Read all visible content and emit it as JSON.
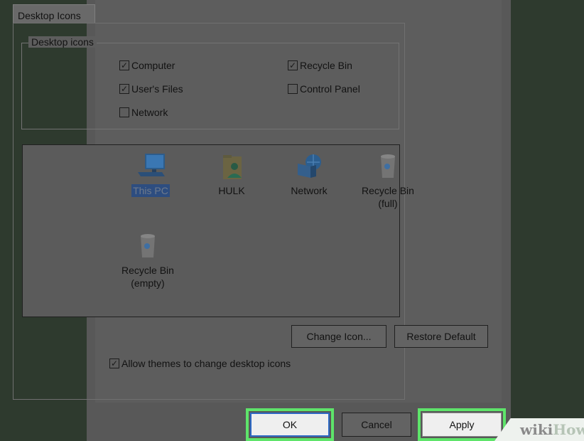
{
  "tab": {
    "label": "Desktop Icons"
  },
  "group": {
    "legend": "Desktop icons",
    "checkboxes": [
      {
        "label": "Computer",
        "checked": true
      },
      {
        "label": "User's Files",
        "checked": true
      },
      {
        "label": "Network",
        "checked": false
      },
      {
        "label": "Recycle Bin",
        "checked": true
      },
      {
        "label": "Control Panel",
        "checked": false
      }
    ]
  },
  "icons": [
    {
      "label": "This PC",
      "selected": true,
      "icon": "computer-icon"
    },
    {
      "label": "HULK",
      "selected": false,
      "icon": "user-folder-icon"
    },
    {
      "label": "Network",
      "selected": false,
      "icon": "network-icon"
    },
    {
      "label": "Recycle Bin",
      "label2": "(full)",
      "selected": false,
      "icon": "recycle-bin-full-icon"
    },
    {
      "label": "Recycle Bin",
      "label2": "(empty)",
      "selected": false,
      "icon": "recycle-bin-empty-icon"
    }
  ],
  "buttons": {
    "change_icon": "Change Icon...",
    "restore_default": "Restore Default",
    "ok": "OK",
    "cancel": "Cancel",
    "apply": "Apply"
  },
  "allow_themes": {
    "label": "Allow themes to change desktop icons",
    "checked": true
  },
  "watermark": {
    "wiki": "wiki",
    "how": "How"
  },
  "colors": {
    "highlight": "#5ee46a",
    "selection": "#2d4d80"
  }
}
